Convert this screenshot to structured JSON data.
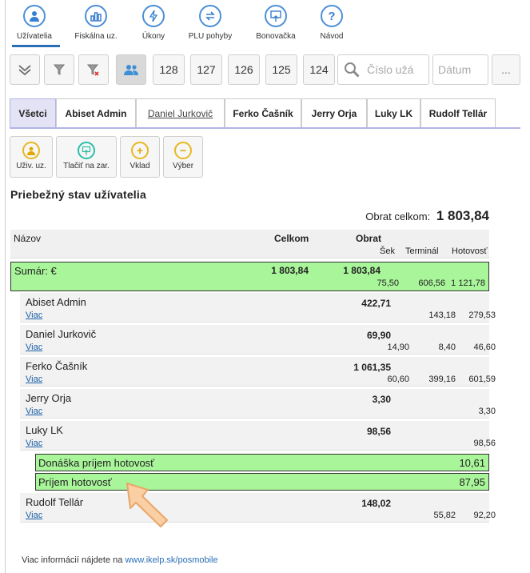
{
  "nav": {
    "items": [
      {
        "label": "Užívatelia",
        "icon": "user-icon"
      },
      {
        "label": "Fiskálna uz.",
        "icon": "bar-chart-icon"
      },
      {
        "label": "Úkony",
        "icon": "lightning-icon"
      },
      {
        "label": "PLU pohyby",
        "icon": "exchange-icon"
      },
      {
        "label": "Bonovačka",
        "icon": "upload-icon"
      },
      {
        "label": "Návod",
        "icon": "help-icon"
      }
    ]
  },
  "toolbar": {
    "numbers": [
      "128",
      "127",
      "126",
      "125",
      "124"
    ],
    "search_placeholder": "Číslo užá",
    "date_placeholder": "Dátum",
    "more_label": "..."
  },
  "tabs": [
    "Všetci",
    "Abiset Admin",
    "Daniel Jurkovič",
    "Ferko Čašník",
    "Jerry Orja",
    "Luky LK",
    "Rudolf Tellár"
  ],
  "actions": [
    {
      "label": "Uživ. uz.",
      "icon": "user-icon"
    },
    {
      "label": "Tlačiť na zar.",
      "icon": "print-upload-icon"
    },
    {
      "label": "Vklad",
      "icon": "plus-icon"
    },
    {
      "label": "Výber",
      "icon": "minus-icon"
    }
  ],
  "section_title": "Priebežný stav užívatelia",
  "total": {
    "label": "Obrat celkom:",
    "value": "1 803,84"
  },
  "table": {
    "headers": {
      "name": "Názov",
      "celkom": "Celkom",
      "obrat": "Obrat",
      "sek": "Šek",
      "terminal": "Terminál",
      "hotovost": "Hotovosť"
    },
    "summary": {
      "label": "Sumár: €",
      "celkom": "1 803,84",
      "obrat": "1 803,84",
      "sek": "75,50",
      "terminal": "606,56",
      "hotovost": "1 121,78"
    },
    "more_label": "Viac",
    "users": [
      {
        "name": "Abiset Admin",
        "obrat": "422,71",
        "sek": "",
        "terminal": "143,18",
        "hotovost": "279,53"
      },
      {
        "name": "Daniel Jurkovič",
        "obrat": "69,90",
        "sek": "14,90",
        "terminal": "8,40",
        "hotovost": "46,60"
      },
      {
        "name": "Ferko Čašník",
        "obrat": "1 061,35",
        "sek": "60,60",
        "terminal": "399,16",
        "hotovost": "601,59"
      },
      {
        "name": "Jerry Orja",
        "obrat": "3,30",
        "sek": "",
        "terminal": "",
        "hotovost": "3,30"
      },
      {
        "name": "Luky LK",
        "obrat": "98,56",
        "sek": "",
        "terminal": "",
        "hotovost": "98,56"
      }
    ],
    "cash_rows": [
      {
        "label": "Donáška príjem hotovosť",
        "value": "10,61"
      },
      {
        "label": "Príjem hotovosť",
        "value": "87,95"
      }
    ],
    "last_user": {
      "name": "Rudolf Tellár",
      "obrat": "148,02",
      "sek": "",
      "terminal": "55,82",
      "hotovost": "92,20"
    }
  },
  "footer": {
    "text": "Viac informácií nájdete na",
    "link": "www.ikelp.sk/posmobile"
  },
  "colors": {
    "accent": "#2a6fb6",
    "highlight_green": "#a9f59a",
    "arrow": "#f7c28d"
  }
}
